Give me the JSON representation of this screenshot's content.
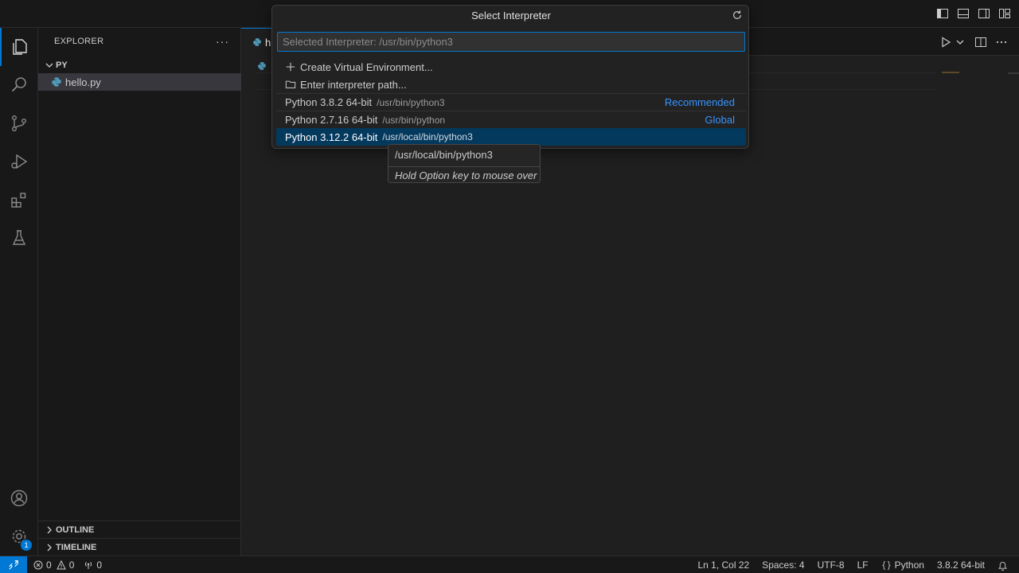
{
  "sidebar": {
    "title": "EXPLORER",
    "more": "···",
    "folder": "PY",
    "file": "hello.py",
    "outline": "OUTLINE",
    "timeline": "TIMELINE"
  },
  "activity": {
    "settings_badge": "1"
  },
  "editor": {
    "tab_label": "h"
  },
  "quickpick": {
    "title": "Select Interpreter",
    "placeholder": "Selected Interpreter: /usr/bin/python3",
    "items": [
      {
        "label": "Create Virtual Environment...",
        "icon": "plus-icon"
      },
      {
        "label": "Enter interpreter path...",
        "icon": "folder-icon"
      },
      {
        "label": "Python 3.8.2 64-bit",
        "description": "/usr/bin/python3",
        "tag": "Recommended"
      },
      {
        "label": "Python 2.7.16 64-bit",
        "description": "/usr/bin/python",
        "tag": "Global"
      },
      {
        "label": "Python 3.12.2 64-bit",
        "description": "/usr/local/bin/python3",
        "selected": true
      }
    ]
  },
  "hover": {
    "path": "/usr/local/bin/python3",
    "hint": "Hold Option key to mouse over"
  },
  "statusbar": {
    "errors": "0",
    "warnings": "0",
    "ports": "0",
    "position": "Ln 1, Col 22",
    "spaces": "Spaces: 4",
    "encoding": "UTF-8",
    "eol": "LF",
    "language": "Python",
    "interpreter": "3.8.2 64-bit"
  },
  "colors": {
    "accent": "#0078d4",
    "selection": "#04395e",
    "link": "#3794ff"
  }
}
